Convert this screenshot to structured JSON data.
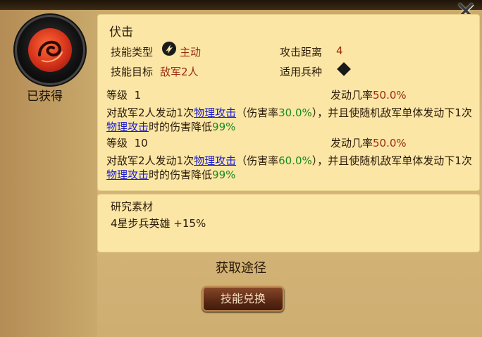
{
  "skill": {
    "name": "伏击",
    "status": "已获得",
    "type_label": "技能类型",
    "type_value": "主动",
    "target_label": "技能目标",
    "target_value": "敌军2人",
    "range_label": "攻击距离",
    "range_value": "4",
    "troop_label": "适用兵种"
  },
  "levels": [
    {
      "level_label": "等级",
      "level": "1",
      "rate_label": "发动几率",
      "rate": "50.0%",
      "desc_a": "对敌军2人发动1次",
      "link1": "物理攻击",
      "desc_b": "（伤害率",
      "damage": "30.0%",
      "desc_c": "），并且使随机敌军单体发动下1次",
      "link2": "物理攻击",
      "desc_d": "时的伤害降低",
      "reduction": "99%"
    },
    {
      "level_label": "等级",
      "level": "10",
      "rate_label": "发动几率",
      "rate": "50.0%",
      "desc_a": "对敌军2人发动1次",
      "link1": "物理攻击",
      "desc_b": "（伤害率",
      "damage": "60.0%",
      "desc_c": "），并且使随机敌军单体发动下1次",
      "link2": "物理攻击",
      "desc_d": "时的伤害降低",
      "reduction": "99%"
    }
  ],
  "research": {
    "title": "研究素材",
    "item": "4星步兵英雄 +15%"
  },
  "acquire_title": "获取途径",
  "exchange_button": "技能兑换",
  "icons": {
    "close": "close-icon",
    "skill": "flame-swirl-icon",
    "type": "active-skill-icon",
    "troop": "infantry-icon"
  }
}
